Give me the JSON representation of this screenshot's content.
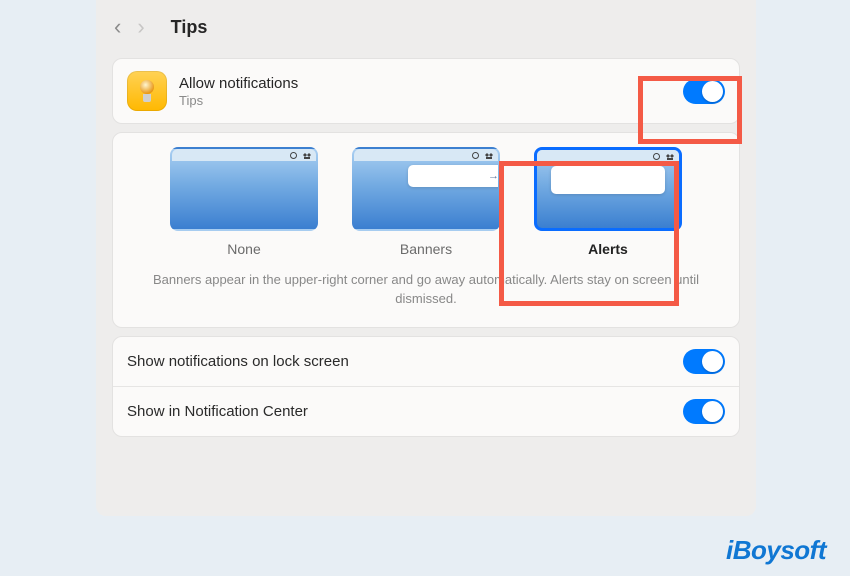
{
  "header": {
    "title": "Tips"
  },
  "allow": {
    "title": "Allow notifications",
    "subtitle": "Tips",
    "enabled": true
  },
  "styles": {
    "options": [
      {
        "label": "None",
        "selected": false
      },
      {
        "label": "Banners",
        "selected": false
      },
      {
        "label": "Alerts",
        "selected": true
      }
    ],
    "description": "Banners appear in the upper-right corner and go away automatically. Alerts stay on screen until dismissed."
  },
  "settings": [
    {
      "label": "Show notifications on lock screen",
      "enabled": true
    },
    {
      "label": "Show in Notification Center",
      "enabled": true
    }
  ],
  "watermark": "iBoysoft"
}
